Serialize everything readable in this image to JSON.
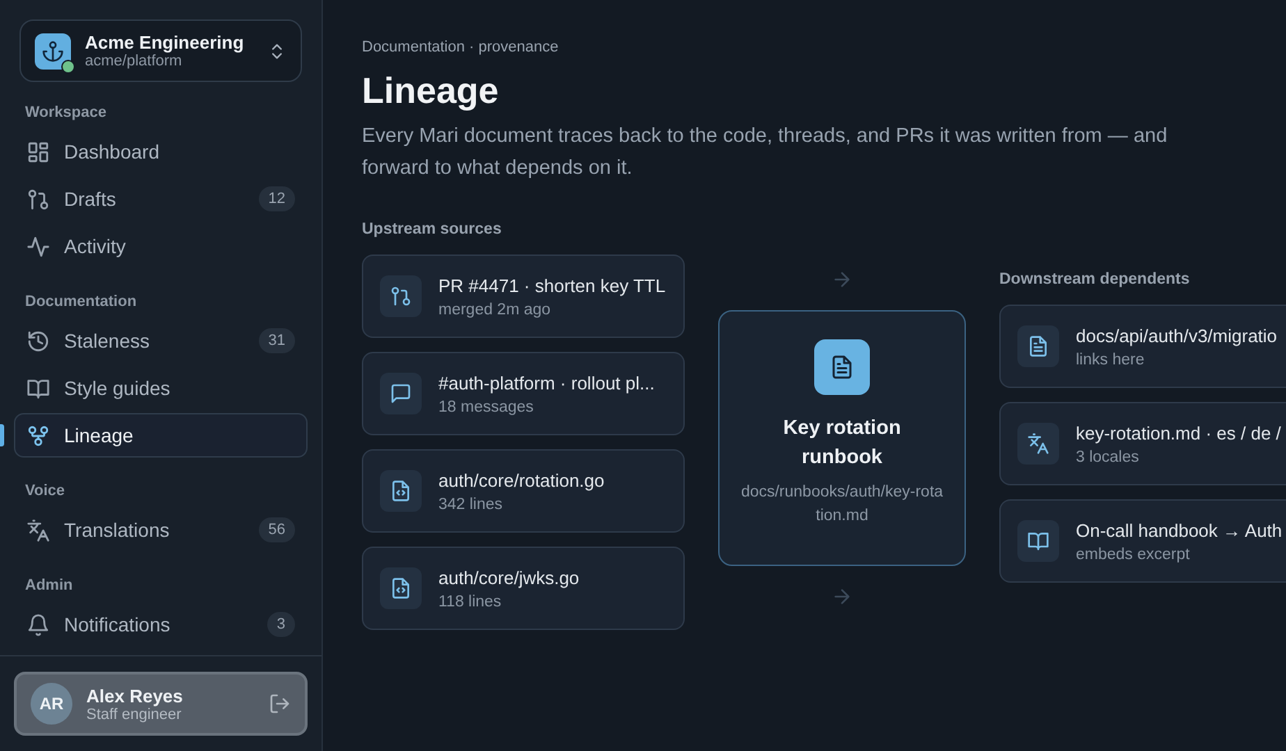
{
  "workspace": {
    "name": "Acme Engineering",
    "repo": "acme/platform",
    "online": true
  },
  "sidebar": {
    "sections": [
      {
        "heading": "Workspace",
        "items": [
          {
            "label": "Dashboard",
            "selected": false
          },
          {
            "label": "Drafts",
            "badge": "12",
            "selected": false
          },
          {
            "label": "Activity",
            "selected": false
          }
        ]
      },
      {
        "heading": "Documentation",
        "items": [
          {
            "label": "Staleness",
            "badge": "31",
            "selected": false
          },
          {
            "label": "Style guides",
            "selected": false
          },
          {
            "label": "Lineage",
            "selected": true
          }
        ]
      },
      {
        "heading": "Voice",
        "items": [
          {
            "label": "Translations",
            "badge": "56",
            "selected": false
          }
        ]
      },
      {
        "heading": "Admin",
        "items": [
          {
            "label": "Notifications",
            "badge": "3",
            "selected": false
          }
        ]
      }
    ]
  },
  "user": {
    "initials": "AR",
    "name": "Alex Reyes",
    "role": "Staff engineer"
  },
  "page": {
    "breadcrumb": "Documentation · provenance",
    "title": "Lineage",
    "description": "Every Mari document traces back to the code, threads, and PRs it was written from — and forward to what depends on it."
  },
  "upstream": {
    "heading": "Upstream sources",
    "items": [
      {
        "title": "PR #4471 · shorten key TTL",
        "meta": "merged 2m ago"
      },
      {
        "title": "#auth-platform · rollout pl...",
        "meta": "18 messages"
      },
      {
        "title": "auth/core/rotation.go",
        "meta": "342 lines"
      },
      {
        "title": "auth/core/jwks.go",
        "meta": "118 lines"
      }
    ]
  },
  "center": {
    "title": "Key rotation runbook",
    "path": "docs/runbooks/auth/key-rotation.md"
  },
  "downstream": {
    "heading": "Downstream dependents",
    "items": [
      {
        "title": "docs/api/auth/v3/migratio",
        "meta": "links here"
      },
      {
        "title": "key-rotation.md · es / de /",
        "meta": "3 locales"
      },
      {
        "title": "On-call handbook → Auth",
        "meta": "embeds excerpt"
      }
    ]
  }
}
